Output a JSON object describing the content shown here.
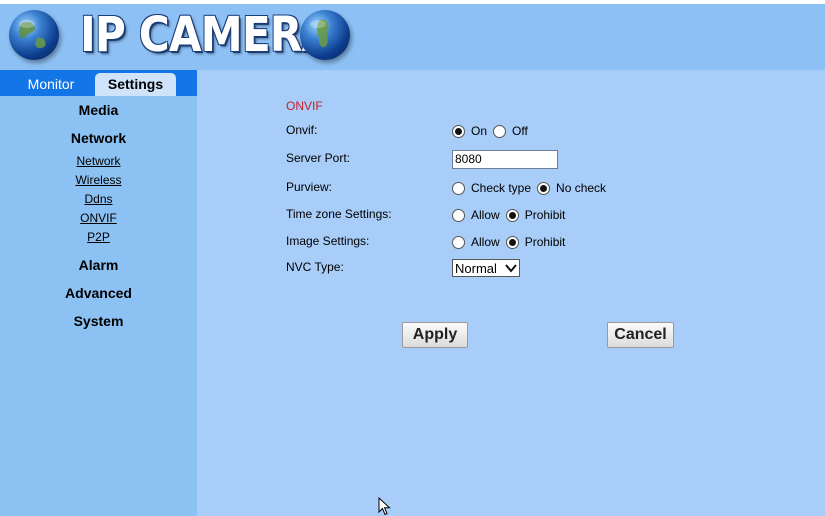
{
  "header": {
    "brand": "IP CAMERA"
  },
  "tabs": [
    {
      "label": "Monitor",
      "active": false
    },
    {
      "label": "Settings",
      "active": true
    }
  ],
  "sidebar": {
    "media": "Media",
    "network": "Network",
    "network_links": [
      "Network",
      "Wireless",
      "Ddns",
      "ONVIF",
      "P2P"
    ],
    "alarm": "Alarm",
    "advanced": "Advanced",
    "system": "System"
  },
  "form": {
    "section_title": "ONVIF",
    "onvif": {
      "label": "Onvif:",
      "options": [
        "On",
        "Off"
      ],
      "selected": "On"
    },
    "server_port": {
      "label": "Server Port:",
      "value": "8080"
    },
    "purview": {
      "label": "Purview:",
      "options": [
        "Check type",
        "No check"
      ],
      "selected": "No check"
    },
    "time_zone": {
      "label": "Time zone Settings:",
      "options": [
        "Allow",
        "Prohibit"
      ],
      "selected": "Prohibit"
    },
    "image": {
      "label": "Image Settings:",
      "options": [
        "Allow",
        "Prohibit"
      ],
      "selected": "Prohibit"
    },
    "nvc_type": {
      "label": "NVC Type:",
      "value": "Normal"
    }
  },
  "buttons": {
    "apply": "Apply",
    "cancel": "Cancel"
  },
  "colors": {
    "banner": "#8dc0f4",
    "tabbar": "#1476e6",
    "sidebar": "#8cc1f4",
    "main": "#a7cdf8",
    "section_title": "#c8202a"
  },
  "icons": [
    "globe-icon",
    "radio-icon",
    "chevron-down-icon",
    "mouse-pointer-icon"
  ]
}
